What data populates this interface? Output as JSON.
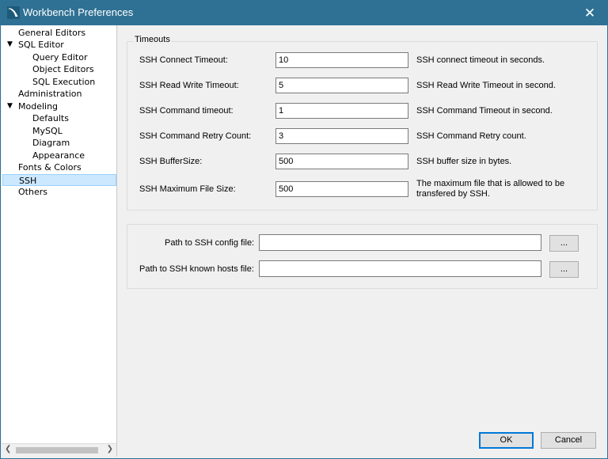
{
  "window": {
    "title": "Workbench Preferences"
  },
  "sidebar": {
    "items": [
      {
        "label": "General Editors",
        "level": 0
      },
      {
        "label": "SQL Editor",
        "level": 0,
        "expanded": true
      },
      {
        "label": "Query Editor",
        "level": 1
      },
      {
        "label": "Object Editors",
        "level": 1
      },
      {
        "label": "SQL Execution",
        "level": 1
      },
      {
        "label": "Administration",
        "level": 0
      },
      {
        "label": "Modeling",
        "level": 0,
        "expanded": true
      },
      {
        "label": "Defaults",
        "level": 1
      },
      {
        "label": "MySQL",
        "level": 1
      },
      {
        "label": "Diagram",
        "level": 1
      },
      {
        "label": "Appearance",
        "level": 1
      },
      {
        "label": "Fonts & Colors",
        "level": 0
      },
      {
        "label": "SSH",
        "level": 0,
        "selected": true
      },
      {
        "label": "Others",
        "level": 0
      }
    ],
    "expand_glyph": "▼"
  },
  "timeouts": {
    "title": "Timeouts",
    "rows": [
      {
        "label": "SSH Connect Timeout:",
        "value": "10",
        "desc": "SSH connect timeout in seconds."
      },
      {
        "label": "SSH Read Write Timeout:",
        "value": "5",
        "desc": "SSH Read Write Timeout in second."
      },
      {
        "label": "SSH Command timeout:",
        "value": "1",
        "desc": "SSH Command Timeout in second."
      },
      {
        "label": "SSH Command Retry Count:",
        "value": "3",
        "desc": "SSH Command Retry count."
      },
      {
        "label": "SSH BufferSize:",
        "value": "500",
        "desc": "SSH buffer size in bytes."
      },
      {
        "label": "SSH Maximum File Size:",
        "value": "500",
        "desc_line1": "The maximum file that is allowed to be",
        "desc_line2": "transfered by SSH."
      }
    ]
  },
  "paths": {
    "config_label": "Path to SSH config file:",
    "config_value": "",
    "known_hosts_label": "Path to SSH known hosts file:",
    "known_hosts_value": "",
    "browse_label": "..."
  },
  "buttons": {
    "ok": "OK",
    "cancel": "Cancel"
  },
  "colors": {
    "titlebar": "#2f7194",
    "selection": "#cce8ff",
    "default_button_border": "#0078d7"
  }
}
